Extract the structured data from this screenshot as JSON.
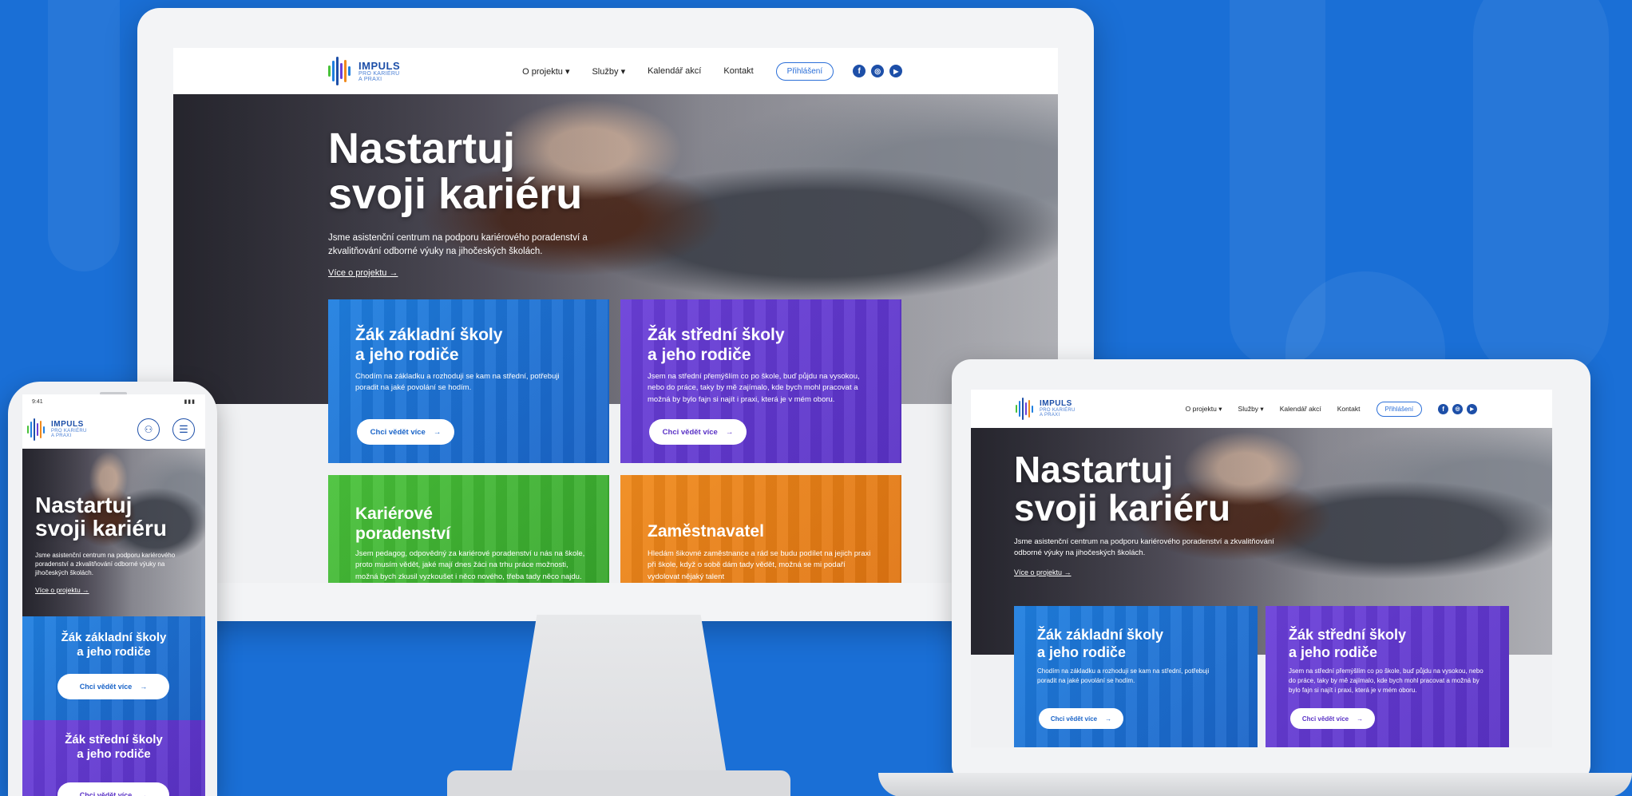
{
  "colors": {
    "background": "#1a6fd6",
    "brand_blue": "#1d4fa8",
    "card_blue": "#1f7fe0",
    "card_purple": "#6a3fd9",
    "card_green": "#49c23a",
    "card_orange": "#f08a1c"
  },
  "logo": {
    "name": "IMPULS",
    "sub_line1": "PRO KARIÉRU",
    "sub_line2": "A PRAXI"
  },
  "nav": {
    "about": "O projektu",
    "services": "Služby",
    "calendar": "Kalendář akcí",
    "contact": "Kontakt",
    "login": "Přihlášení",
    "dropdown_icon": "▾",
    "social": [
      "facebook-icon",
      "instagram-icon",
      "youtube-icon"
    ]
  },
  "phone_status": {
    "time": "9:41"
  },
  "hero": {
    "title_line1": "Nastartuj",
    "title_line2": "svoji kariéru",
    "description": "Jsme asistenční centrum na podporu kariérového poradenství a zkvalitňování odborné výuky na jihočeských školách.",
    "link": "Více o projektu",
    "arrow": "→"
  },
  "cards": {
    "zs": {
      "title_line1": "Žák základní školy",
      "title_line2": "a jeho rodiče",
      "text": "Chodím na základku a rozhoduji se kam na střední, potřebuji poradit na jaké povolání se hodím.",
      "button": "Chci vědět více"
    },
    "ss": {
      "title_line1": "Žák střední školy",
      "title_line2": "a jeho rodiče",
      "text": "Jsem na střední přemýšlím co po škole, buď půjdu na vysokou, nebo do práce, taky by mě zajímalo, kde bych mohl pracovat a možná by bylo fajn si najít i praxi, která je v mém oboru.",
      "button": "Chci vědět více"
    },
    "career": {
      "title_line1": "Kariérové",
      "title_line2": "poradenství",
      "text": "Jsem pedagog, odpovědný za kariérové poradenství u nás na škole, proto musím vědět, jaké mají dnes žáci na trhu práce možnosti, možná bych zkusil vyzkoušet i něco nového, třeba tady něco najdu."
    },
    "employer": {
      "title": "Zaměstnavatel",
      "text": "Hledám šikovné zaměstnance a rád se budu podílet na jejich praxi při škole, když o sobě dám tady vědět, možná se mi podaří vydolovat nějaký talent"
    }
  }
}
